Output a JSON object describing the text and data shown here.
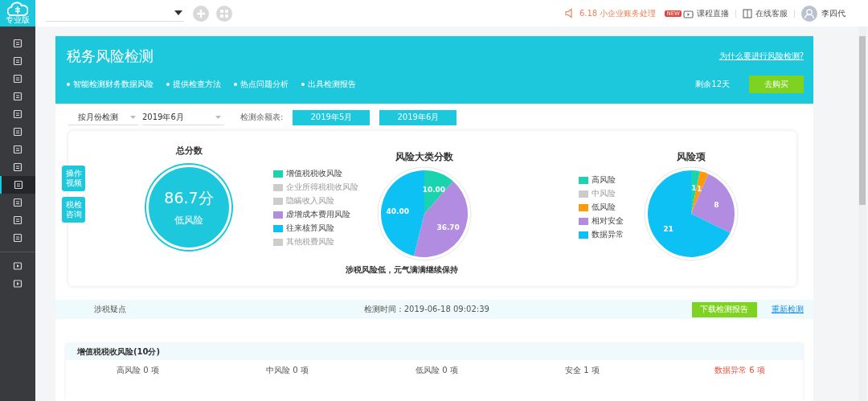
{
  "app": {
    "edition": "专业版"
  },
  "sidebar": {
    "items": [
      {
        "selected": false
      },
      {
        "selected": false
      },
      {
        "selected": false
      },
      {
        "selected": false
      },
      {
        "selected": false
      },
      {
        "selected": false
      },
      {
        "selected": false
      },
      {
        "selected": false
      },
      {
        "selected": true
      },
      {
        "selected": false
      },
      {
        "selected": false
      },
      {
        "selected": false
      }
    ],
    "bottom_items": [
      {
        "selected": false
      },
      {
        "selected": false
      }
    ]
  },
  "topbar": {
    "notice": "6.18 小企业账务处理",
    "badge": "NEW",
    "links": [
      {
        "label": "课程直播",
        "kind": "tv"
      },
      {
        "label": "在线客服",
        "kind": "book"
      }
    ],
    "user": "李四代"
  },
  "header": {
    "title": "税务风险检测",
    "link": "为什么要进行风险检测?",
    "features": [
      "智能检测财务数据风险",
      "提供检查方法",
      "热点问题分析",
      "出具检测报告"
    ],
    "remaining": "剩余12天",
    "buy_button": "去购买"
  },
  "filters": {
    "mode": "按月份检测",
    "month": "2019年6月",
    "label": "检测余额表:",
    "buttons": [
      "2019年5月",
      "2019年6月"
    ]
  },
  "side_buttons": [
    "操作视频",
    "税检咨询"
  ],
  "score": {
    "title": "总分数",
    "value": "86.7分",
    "level": "低风险"
  },
  "category_chart": {
    "chart_data": {
      "type": "pie",
      "title": "风险大类分数",
      "categories": [
        "增值税税收风险",
        "企业所得税税收风险",
        "隐瞒收入风险",
        "虚增成本费用风险",
        "往来核算风险",
        "其他税费风险"
      ],
      "values": [
        10.0,
        null,
        null,
        36.7,
        40.0,
        null
      ],
      "colors": [
        "#19d4ae",
        null,
        null,
        "#b28ce0",
        "#0ec1f5",
        null
      ],
      "data_labels": true,
      "value_labels": [
        "10.00",
        null,
        null,
        "36.70",
        "40.00",
        null
      ]
    },
    "summary": "涉税风险低，元气满满继续保持"
  },
  "item_chart": {
    "chart_data": {
      "type": "pie",
      "title": "风险项",
      "categories": [
        "高风险",
        "中风险",
        "低风险",
        "相对安全",
        "数据异常"
      ],
      "values": [
        1,
        null,
        1,
        8,
        21
      ],
      "colors": [
        "#19d4ae",
        null,
        "#ff9a0a",
        "#b28ce0",
        "#0ec1f5"
      ],
      "data_labels": true,
      "value_labels": [
        "1",
        null,
        "1",
        "8",
        "21"
      ]
    }
  },
  "result_bar": {
    "label": "涉税疑点",
    "time": "检测时间 : 2019-06-18 09:02:39",
    "download_button": "下载检测报告",
    "recheck_link": "重新检测"
  },
  "section": {
    "title": "增值税税收风险(10分)",
    "stats": [
      {
        "label": "高风险 0 项",
        "kind": "normal"
      },
      {
        "label": "中风险 0 项",
        "kind": "normal"
      },
      {
        "label": "低风险 0 项",
        "kind": "normal"
      },
      {
        "label": "安全 1 项",
        "kind": "normal"
      },
      {
        "label": "数据异常 6 项",
        "kind": "alert"
      }
    ]
  }
}
